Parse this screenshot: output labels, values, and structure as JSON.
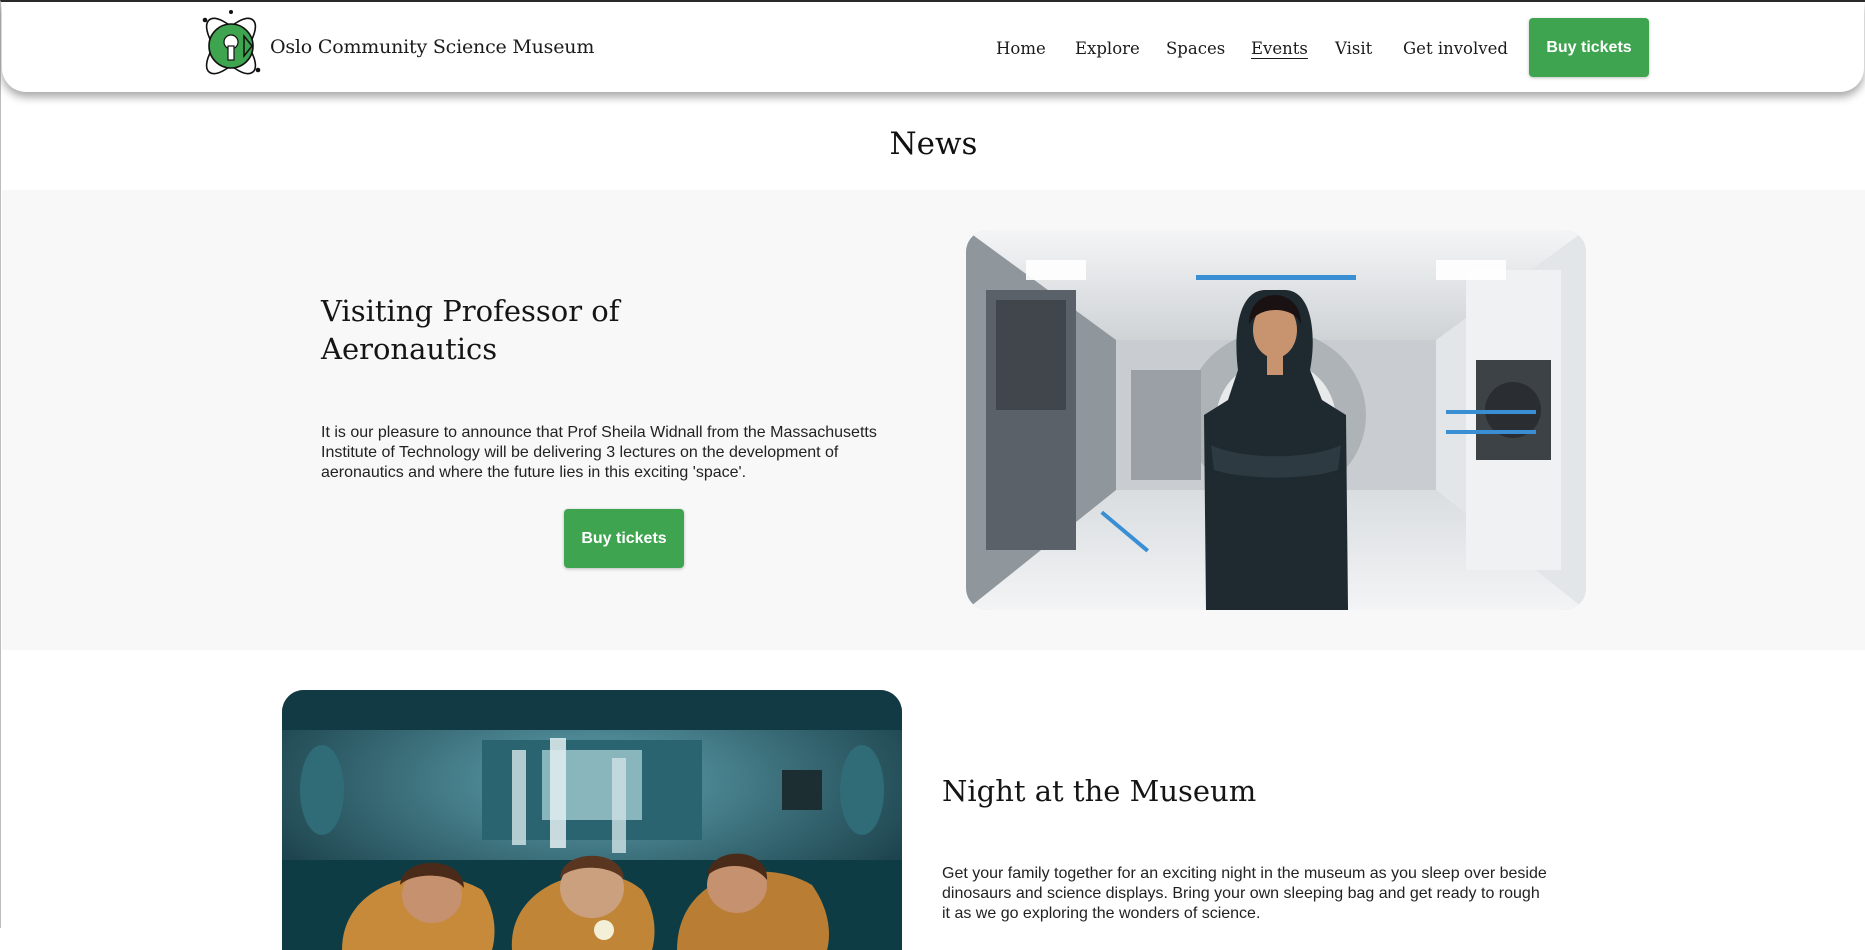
{
  "header": {
    "brand": "Oslo Community Science Museum",
    "nav": [
      "Home",
      "Explore",
      "Spaces",
      "Events",
      "Visit",
      "Get involved"
    ],
    "active_nav": "Events",
    "buy_label": "Buy tickets"
  },
  "page": {
    "title": "News"
  },
  "articles": [
    {
      "title_line1": "Visiting Professor of",
      "title_line2": "Aeronautics",
      "body_line1": "It is our pleasure to announce that Prof Sheila Widnall from the Massachusetts",
      "body_line2": "Institute of Technology will be delivering 3 lectures on the development of",
      "body_line3": "aeronautics and where the future lies in this exciting 'space'.",
      "button": "Buy tickets",
      "image": "professor-in-space-station-photo"
    },
    {
      "title": "Night at the Museum",
      "body_line1": "Get your family together for an exciting night in the museum as you sleep over beside",
      "body_line2": "dinosaurs and science displays. Bring your own sleeping bag and get ready to rough",
      "body_line3": "it as we go exploring the wonders of science.",
      "image": "children-in-sleeping-bags-photo"
    }
  ],
  "colors": {
    "accent": "#3ea44f",
    "section_bg": "#f8f8f8"
  }
}
